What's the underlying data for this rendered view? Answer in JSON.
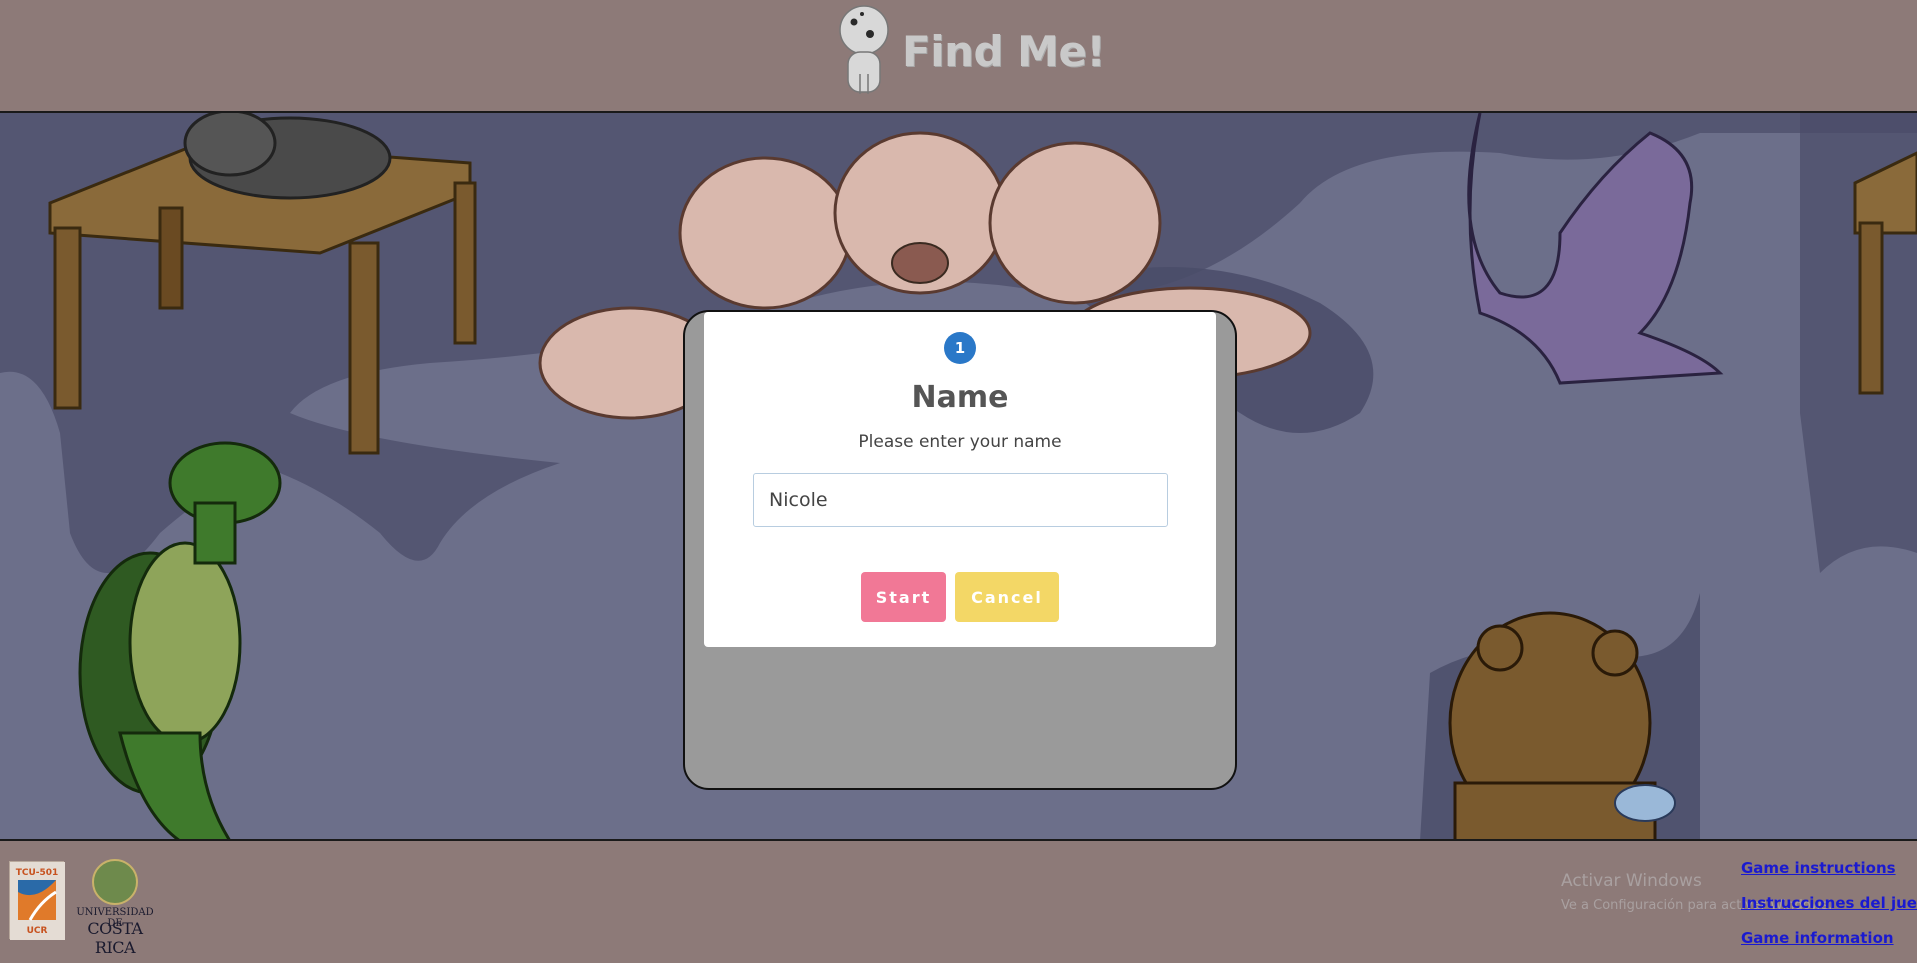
{
  "header": {
    "title": "Find Me!",
    "logo_icon": "kodama-spirit-icon"
  },
  "modal": {
    "step_number": "1",
    "title": "Name",
    "subtitle": "Please enter your name",
    "input_value": "Nicole",
    "start_label": "Start",
    "cancel_label": "Cancel"
  },
  "footer": {
    "tcu_logo_text": "TCU-501 UCR",
    "ucr_line1": "UNIVERSIDAD DE",
    "ucr_line2": "COSTA RICA",
    "watermark_title": "Activar Windows",
    "watermark_sub": "Ve a Configuración para activar Windows.",
    "links": [
      "Game instructions",
      "Instrucciones del juego",
      "Game information"
    ]
  },
  "colors": {
    "header_bg": "#8d7a78",
    "scene_bg": "#6c6f8a",
    "step_badge": "#2a78c8",
    "start_button": "#f17896",
    "cancel_button": "#f3d766",
    "link": "#1a1ad0"
  }
}
